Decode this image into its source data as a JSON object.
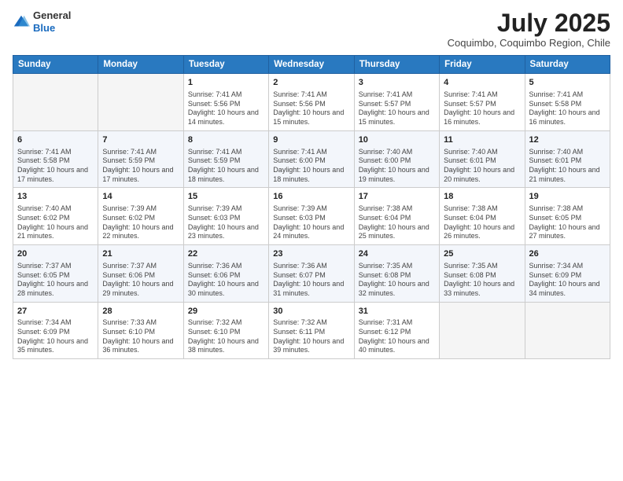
{
  "logo": {
    "general": "General",
    "blue": "Blue"
  },
  "header": {
    "month": "July 2025",
    "location": "Coquimbo, Coquimbo Region, Chile"
  },
  "weekdays": [
    "Sunday",
    "Monday",
    "Tuesday",
    "Wednesday",
    "Thursday",
    "Friday",
    "Saturday"
  ],
  "weeks": [
    [
      {
        "day": "",
        "info": ""
      },
      {
        "day": "",
        "info": ""
      },
      {
        "day": "1",
        "info": "Sunrise: 7:41 AM\nSunset: 5:56 PM\nDaylight: 10 hours and 14 minutes."
      },
      {
        "day": "2",
        "info": "Sunrise: 7:41 AM\nSunset: 5:56 PM\nDaylight: 10 hours and 15 minutes."
      },
      {
        "day": "3",
        "info": "Sunrise: 7:41 AM\nSunset: 5:57 PM\nDaylight: 10 hours and 15 minutes."
      },
      {
        "day": "4",
        "info": "Sunrise: 7:41 AM\nSunset: 5:57 PM\nDaylight: 10 hours and 16 minutes."
      },
      {
        "day": "5",
        "info": "Sunrise: 7:41 AM\nSunset: 5:58 PM\nDaylight: 10 hours and 16 minutes."
      }
    ],
    [
      {
        "day": "6",
        "info": "Sunrise: 7:41 AM\nSunset: 5:58 PM\nDaylight: 10 hours and 17 minutes."
      },
      {
        "day": "7",
        "info": "Sunrise: 7:41 AM\nSunset: 5:59 PM\nDaylight: 10 hours and 17 minutes."
      },
      {
        "day": "8",
        "info": "Sunrise: 7:41 AM\nSunset: 5:59 PM\nDaylight: 10 hours and 18 minutes."
      },
      {
        "day": "9",
        "info": "Sunrise: 7:41 AM\nSunset: 6:00 PM\nDaylight: 10 hours and 18 minutes."
      },
      {
        "day": "10",
        "info": "Sunrise: 7:40 AM\nSunset: 6:00 PM\nDaylight: 10 hours and 19 minutes."
      },
      {
        "day": "11",
        "info": "Sunrise: 7:40 AM\nSunset: 6:01 PM\nDaylight: 10 hours and 20 minutes."
      },
      {
        "day": "12",
        "info": "Sunrise: 7:40 AM\nSunset: 6:01 PM\nDaylight: 10 hours and 21 minutes."
      }
    ],
    [
      {
        "day": "13",
        "info": "Sunrise: 7:40 AM\nSunset: 6:02 PM\nDaylight: 10 hours and 21 minutes."
      },
      {
        "day": "14",
        "info": "Sunrise: 7:39 AM\nSunset: 6:02 PM\nDaylight: 10 hours and 22 minutes."
      },
      {
        "day": "15",
        "info": "Sunrise: 7:39 AM\nSunset: 6:03 PM\nDaylight: 10 hours and 23 minutes."
      },
      {
        "day": "16",
        "info": "Sunrise: 7:39 AM\nSunset: 6:03 PM\nDaylight: 10 hours and 24 minutes."
      },
      {
        "day": "17",
        "info": "Sunrise: 7:38 AM\nSunset: 6:04 PM\nDaylight: 10 hours and 25 minutes."
      },
      {
        "day": "18",
        "info": "Sunrise: 7:38 AM\nSunset: 6:04 PM\nDaylight: 10 hours and 26 minutes."
      },
      {
        "day": "19",
        "info": "Sunrise: 7:38 AM\nSunset: 6:05 PM\nDaylight: 10 hours and 27 minutes."
      }
    ],
    [
      {
        "day": "20",
        "info": "Sunrise: 7:37 AM\nSunset: 6:05 PM\nDaylight: 10 hours and 28 minutes."
      },
      {
        "day": "21",
        "info": "Sunrise: 7:37 AM\nSunset: 6:06 PM\nDaylight: 10 hours and 29 minutes."
      },
      {
        "day": "22",
        "info": "Sunrise: 7:36 AM\nSunset: 6:06 PM\nDaylight: 10 hours and 30 minutes."
      },
      {
        "day": "23",
        "info": "Sunrise: 7:36 AM\nSunset: 6:07 PM\nDaylight: 10 hours and 31 minutes."
      },
      {
        "day": "24",
        "info": "Sunrise: 7:35 AM\nSunset: 6:08 PM\nDaylight: 10 hours and 32 minutes."
      },
      {
        "day": "25",
        "info": "Sunrise: 7:35 AM\nSunset: 6:08 PM\nDaylight: 10 hours and 33 minutes."
      },
      {
        "day": "26",
        "info": "Sunrise: 7:34 AM\nSunset: 6:09 PM\nDaylight: 10 hours and 34 minutes."
      }
    ],
    [
      {
        "day": "27",
        "info": "Sunrise: 7:34 AM\nSunset: 6:09 PM\nDaylight: 10 hours and 35 minutes."
      },
      {
        "day": "28",
        "info": "Sunrise: 7:33 AM\nSunset: 6:10 PM\nDaylight: 10 hours and 36 minutes."
      },
      {
        "day": "29",
        "info": "Sunrise: 7:32 AM\nSunset: 6:10 PM\nDaylight: 10 hours and 38 minutes."
      },
      {
        "day": "30",
        "info": "Sunrise: 7:32 AM\nSunset: 6:11 PM\nDaylight: 10 hours and 39 minutes."
      },
      {
        "day": "31",
        "info": "Sunrise: 7:31 AM\nSunset: 6:12 PM\nDaylight: 10 hours and 40 minutes."
      },
      {
        "day": "",
        "info": ""
      },
      {
        "day": "",
        "info": ""
      }
    ]
  ]
}
